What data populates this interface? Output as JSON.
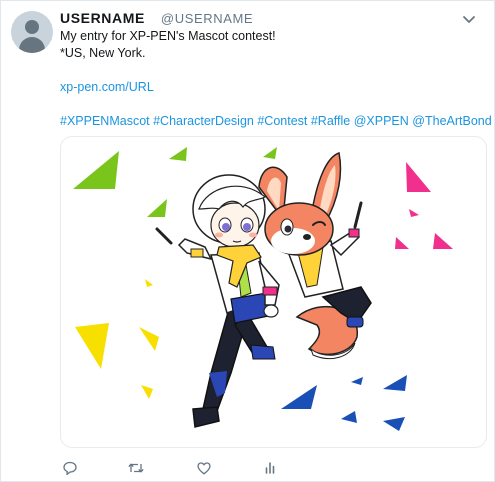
{
  "user": {
    "display_name": "USERNAME",
    "handle": "@USERNAME"
  },
  "tweet": {
    "lines": [
      "My entry for XP-PEN's Mascot contest!",
      "*US, New York."
    ],
    "link": "xp-pen.com/URL",
    "tags": [
      "#XPPENMascot",
      "#CharacterDesign",
      "#Contest",
      "#Raffle",
      "@XPPEN",
      "@TheArtBond"
    ]
  },
  "media": {
    "description_icon": "mascot-illustration"
  },
  "actions": {
    "icons": [
      "reply-icon",
      "retweet-icon",
      "like-icon",
      "analytics-icon"
    ]
  },
  "colors": {
    "link": "#1b95e0",
    "green_triangle": "#7ac51c",
    "yellow_triangle": "#f7e000",
    "pink_triangle": "#f0308c",
    "blue_triangle": "#1a4fb5",
    "fox_orange": "#f48562"
  }
}
